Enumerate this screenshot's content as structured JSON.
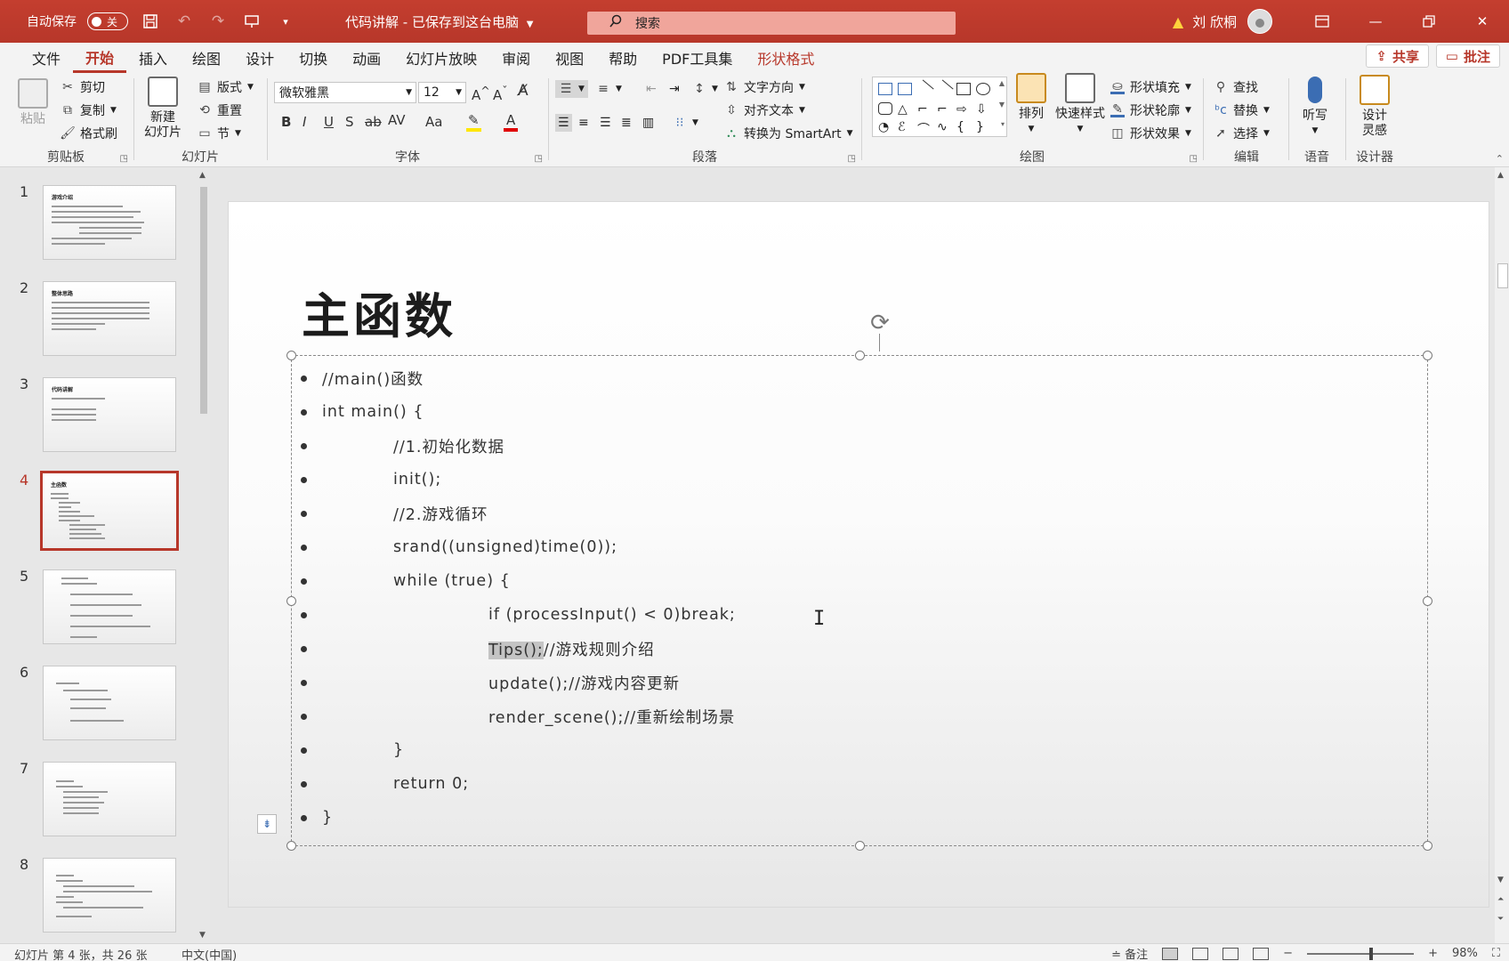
{
  "titlebar": {
    "autosave_label": "自动保存",
    "autosave_state": "关",
    "doc_title": "代码讲解 - 已保存到这台电脑",
    "search_placeholder": "搜索",
    "user_name": "刘 欣桐",
    "accent_color": "#b7372a"
  },
  "ribbon_tabs": [
    "文件",
    "开始",
    "插入",
    "绘图",
    "设计",
    "切换",
    "动画",
    "幻灯片放映",
    "审阅",
    "视图",
    "帮助",
    "PDF工具集",
    "形状格式"
  ],
  "ribbon_active_tab": "开始",
  "share_label": "共享",
  "comment_label": "批注",
  "ribbon": {
    "clipboard": {
      "label": "剪贴板",
      "paste": "粘贴",
      "cut": "剪切",
      "copy": "复制",
      "format_painter": "格式刷"
    },
    "slides": {
      "label": "幻灯片",
      "new_slide_line1": "新建",
      "new_slide_line2": "幻灯片",
      "layout": "版式",
      "reset": "重置",
      "section": "节"
    },
    "font": {
      "label": "字体",
      "font_name": "微软雅黑",
      "font_size": "12",
      "bold": "B",
      "italic": "I",
      "underline": "U",
      "shadow": "S",
      "strike": "ab",
      "spacing": "AV",
      "case": "Aa"
    },
    "paragraph": {
      "label": "段落",
      "text_direction": "文字方向",
      "align_text": "对齐文本",
      "smartart": "转换为 SmartArt"
    },
    "drawing": {
      "label": "绘图",
      "arrange": "排列",
      "quick_styles": "快速样式",
      "shape_fill": "形状填充",
      "shape_outline": "形状轮廓",
      "shape_effects": "形状效果"
    },
    "editing": {
      "label": "编辑",
      "find": "查找",
      "replace": "替换",
      "select": "选择"
    },
    "voice": {
      "label": "语音",
      "dictate": "听写"
    },
    "designer": {
      "label": "设计器",
      "design_ideas_line1": "设计",
      "design_ideas_line2": "灵感"
    }
  },
  "slides_panel": [
    {
      "num": "1",
      "title": "游戏介绍"
    },
    {
      "num": "2",
      "title": "整体思路"
    },
    {
      "num": "3",
      "title": "代码讲解"
    },
    {
      "num": "4",
      "title": "主函数",
      "active": true
    },
    {
      "num": "5",
      "title": ""
    },
    {
      "num": "6",
      "title": ""
    },
    {
      "num": "7",
      "title": ""
    },
    {
      "num": "8",
      "title": ""
    }
  ],
  "slide": {
    "title": "主函数",
    "lines": [
      {
        "indent": 0,
        "text": "//main()函数"
      },
      {
        "indent": 0,
        "text": "int main() {"
      },
      {
        "indent": 1,
        "text": "//1.初始化数据"
      },
      {
        "indent": 1,
        "text": "init();"
      },
      {
        "indent": 1,
        "text": "//2.游戏循环"
      },
      {
        "indent": 1,
        "text": "srand((unsigned)time(0));"
      },
      {
        "indent": 1,
        "text": "while (true) {"
      },
      {
        "indent": 2,
        "text": "if (processInput() < 0)break;"
      },
      {
        "indent": 2,
        "text": "Tips();//游戏规则介绍",
        "highlight": "Tips();"
      },
      {
        "indent": 2,
        "text": "update();//游戏内容更新"
      },
      {
        "indent": 2,
        "text": "render_scene();//重新绘制场景"
      },
      {
        "indent": 1,
        "text": "}"
      },
      {
        "indent": 1,
        "text": "return 0;"
      },
      {
        "indent": 0,
        "text": "}"
      }
    ]
  },
  "statusbar": {
    "slide_info": "幻灯片 第 4 张，共 26 张",
    "language": "中文(中国)",
    "notes": "备注",
    "zoom": "98%"
  }
}
